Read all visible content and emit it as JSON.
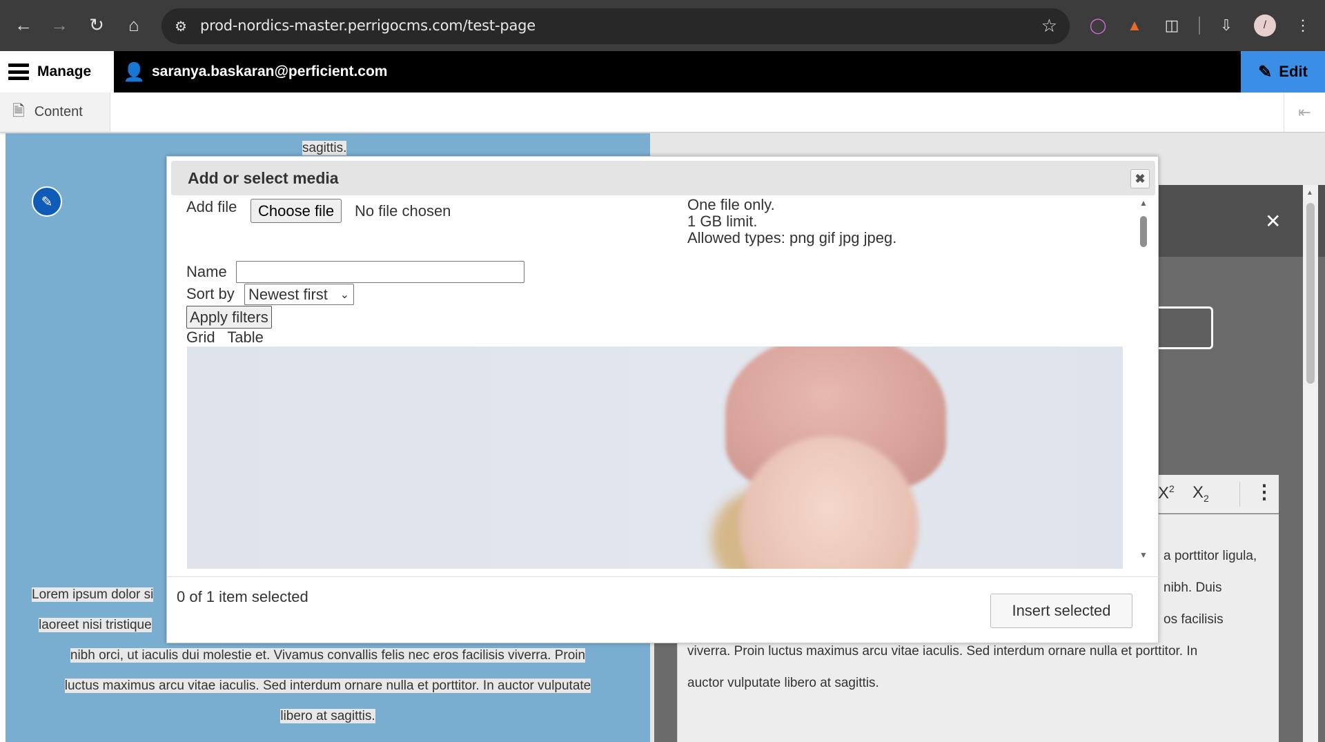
{
  "browser": {
    "url": "prod-nordics-master.perrigocms.com/test-page",
    "profile_initial": "/"
  },
  "toolbar": {
    "manage_label": "Manage",
    "user_email": "saranya.baskaran@perficient.com",
    "edit_label": "Edit",
    "content_tab": "Content"
  },
  "page": {
    "top_text": "sagittis.",
    "left_lines": [
      "Lorem ipsum dolor si",
      "laoreet nisi tristique",
      "nibh orci, ut iaculis dui molestie et. Vivamus convallis felis nec eros facilisis viverra. Proin",
      "luctus maximus arcu vitae iaculis. Sed interdum ornare nulla et porttitor. In auctor vulputate",
      "libero at sagittis."
    ],
    "right_lines": [
      "a porttitor ligula,",
      "nibh. Duis",
      "os facilisis",
      "viverra. Proin luctus maximus arcu vitae iaculis. Sed interdum ornare nulla et porttitor. In",
      "auctor vulputate libero at sagittis."
    ],
    "superscript_label": "X",
    "superscript_mark": "2",
    "subscript_label": "X",
    "subscript_mark": "2"
  },
  "modal": {
    "title": "Add or select media",
    "add_file_label": "Add file",
    "choose_file_label": "Choose file",
    "no_file_text": "No file chosen",
    "info_lines": [
      "One file only.",
      "1 GB limit.",
      "Allowed types: png gif jpg jpeg."
    ],
    "name_label": "Name",
    "name_value": "",
    "sort_label": "Sort by",
    "sort_value": "Newest first",
    "apply_label": "Apply filters",
    "view_grid": "Grid",
    "view_table": "Table",
    "selected_count": "0 of 1 item selected",
    "insert_label": "Insert selected"
  }
}
